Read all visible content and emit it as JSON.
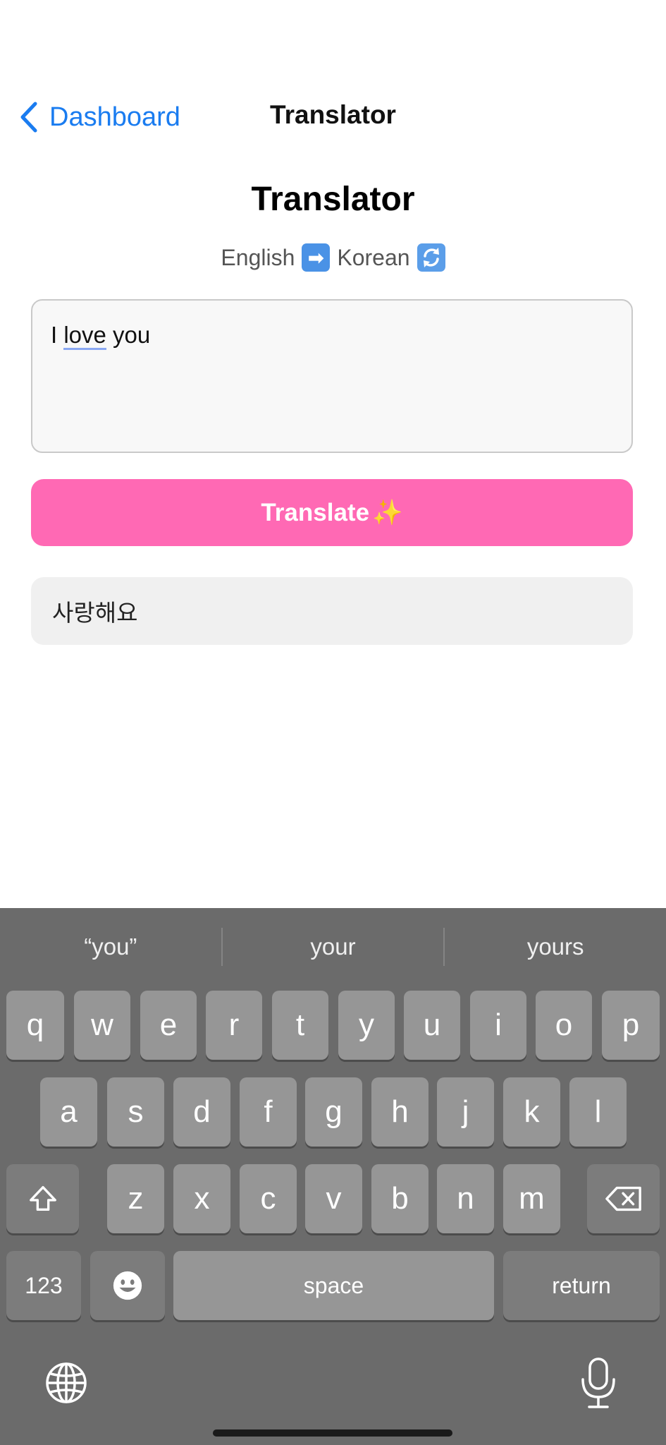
{
  "nav": {
    "back_label": "Dashboard",
    "title": "Translator"
  },
  "main": {
    "title": "Translator",
    "source_language": "English",
    "arrow_emoji": "➡",
    "target_language": "Korean",
    "swap_emoji": "🔄",
    "input_text_prefix": "I ",
    "input_text_underlined": "love",
    "input_text_suffix": " you",
    "translate_label": "Translate",
    "translate_sparkle": "✨",
    "output_text": "사랑해요"
  },
  "keyboard": {
    "suggestions": [
      "“you”",
      "your",
      "yours"
    ],
    "row1": [
      "q",
      "w",
      "e",
      "r",
      "t",
      "y",
      "u",
      "i",
      "o",
      "p"
    ],
    "row2": [
      "a",
      "s",
      "d",
      "f",
      "g",
      "h",
      "j",
      "k",
      "l"
    ],
    "row3": [
      "z",
      "x",
      "c",
      "v",
      "b",
      "n",
      "m"
    ],
    "numbers_label": "123",
    "space_label": "space",
    "return_label": "return"
  },
  "icons": {
    "back": "chevron-left-icon",
    "shift": "shift-icon",
    "delete": "delete-icon",
    "emoji": "emoji-icon",
    "globe": "globe-icon",
    "mic": "microphone-icon"
  },
  "colors": {
    "accent": "#1a7cf0",
    "translate_button": "#ff69b4",
    "keyboard_bg": "#6b6b6b"
  }
}
